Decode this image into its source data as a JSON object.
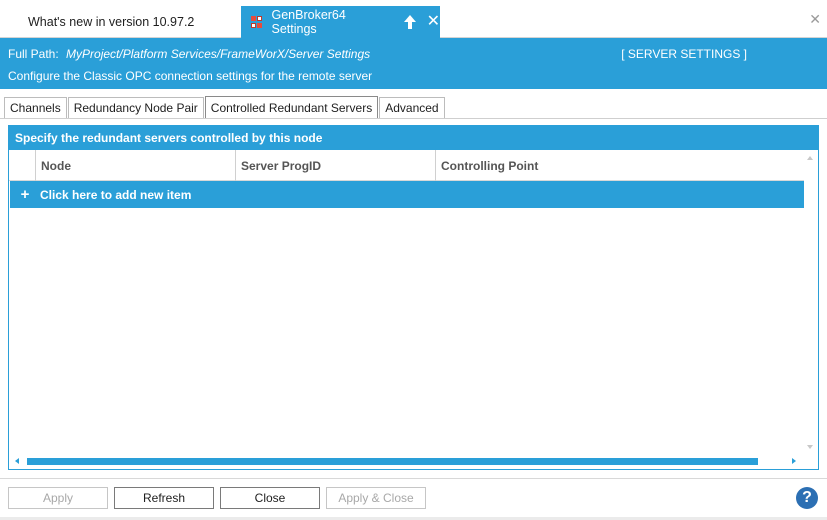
{
  "doc_tabs": {
    "inactive_label": "What's new in version 10.97.2",
    "active_label": "GenBroker64 Settings"
  },
  "header": {
    "full_path_label": "Full Path:",
    "full_path_value": "MyProject/Platform Services/FrameWorX/Server Settings",
    "section_tag": "[ SERVER SETTINGS ]",
    "description": "Configure the Classic OPC connection settings for the remote server"
  },
  "tabs": [
    {
      "label": "Channels"
    },
    {
      "label": "Redundancy Node Pair"
    },
    {
      "label": "Controlled Redundant Servers"
    },
    {
      "label": "Advanced"
    }
  ],
  "panel": {
    "title": "Specify the redundant servers controlled by this node",
    "columns": [
      "Node",
      "Server ProgID",
      "Controlling Point"
    ],
    "add_row_label": "Click here to add new item"
  },
  "footer": {
    "apply_label": "Apply",
    "refresh_label": "Refresh",
    "close_label": "Close",
    "apply_close_label": "Apply & Close",
    "help_glyph": "?"
  },
  "colors": {
    "accent": "#2a9fd8",
    "help": "#2c6fb3"
  }
}
